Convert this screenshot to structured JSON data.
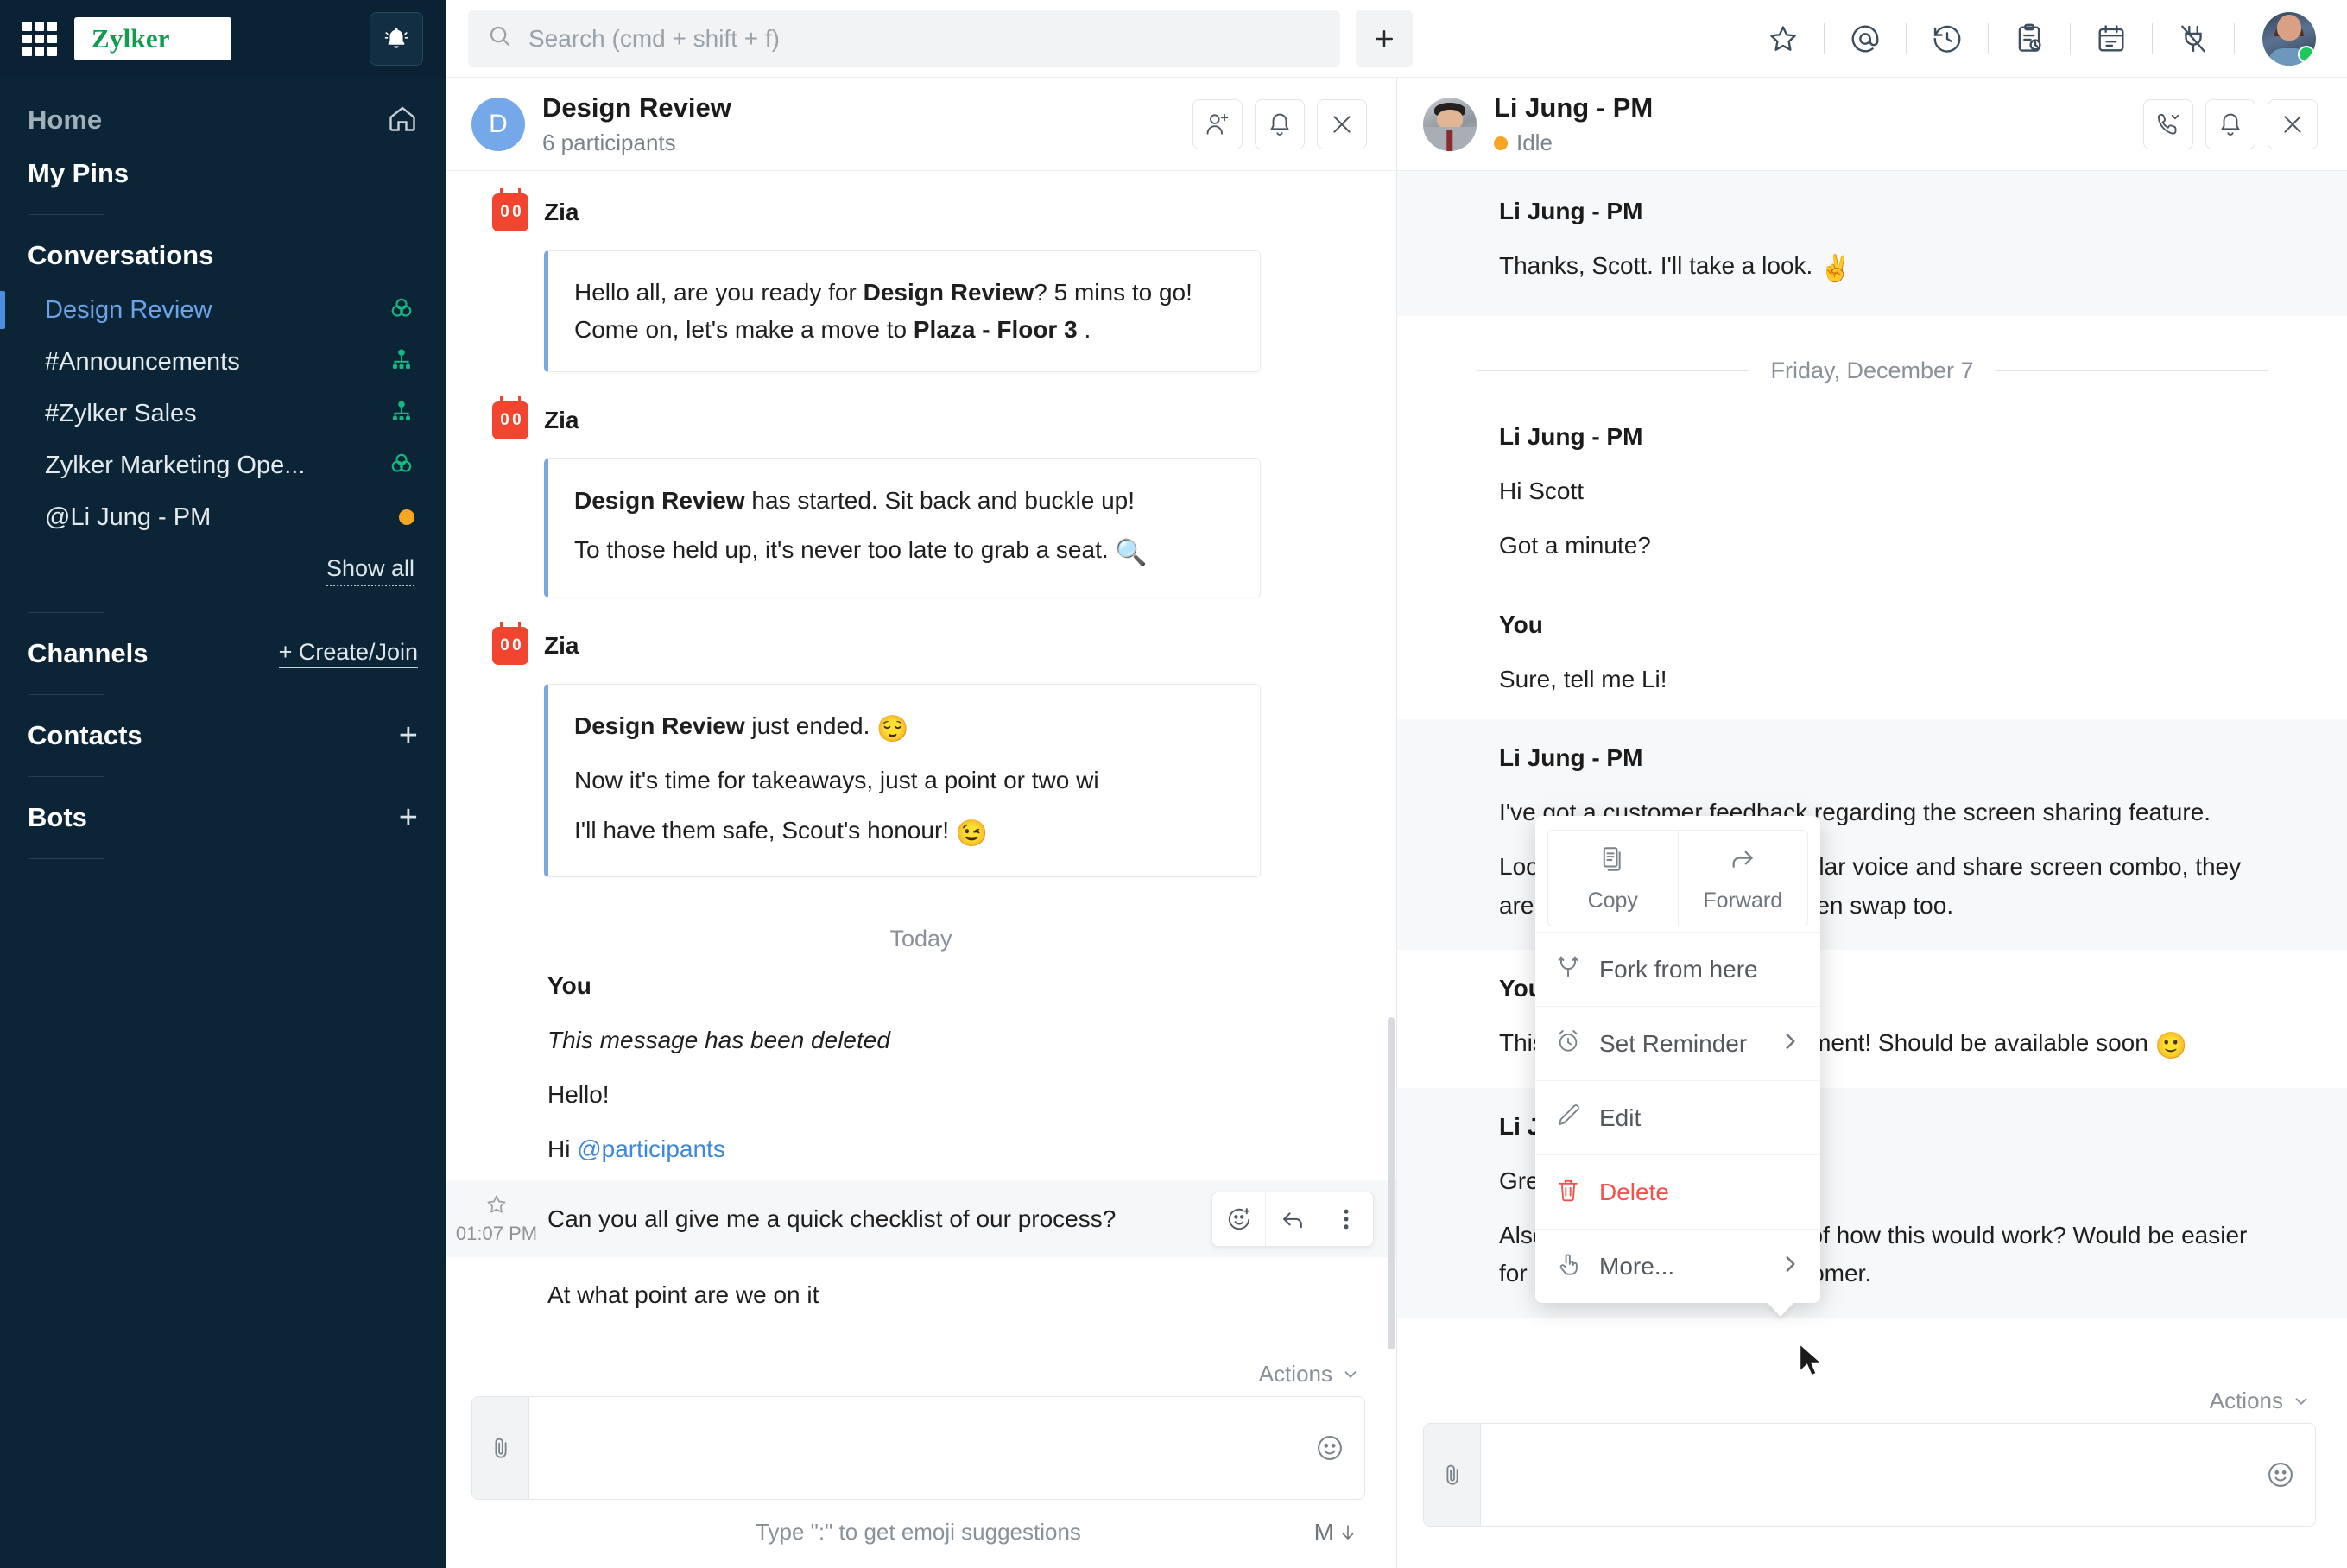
{
  "sidebar": {
    "brand": "Zylker",
    "grid_icon": "apps-grid-icon",
    "bell_icon": "notifications-bell-icon",
    "home": {
      "label": "Home",
      "icon": "home-icon"
    },
    "my_pins": {
      "label": "My Pins"
    },
    "conversations": {
      "title": "Conversations",
      "items": [
        {
          "label": "Design Review",
          "icon": "group-chat-icon",
          "active": true
        },
        {
          "label": "#Announcements",
          "icon": "channel-hierarchy-icon",
          "active": false
        },
        {
          "label": "#Zylker Sales",
          "icon": "channel-hierarchy-icon",
          "active": false
        },
        {
          "label": "Zylker Marketing Ope...",
          "icon": "group-chat-icon",
          "active": false
        },
        {
          "label": "@Li Jung - PM",
          "icon": "status-idle-dot",
          "active": false
        }
      ],
      "show_all": "Show all"
    },
    "channels": {
      "title": "Channels",
      "action": "+ Create/Join"
    },
    "contacts": {
      "title": "Contacts",
      "action_icon": "plus-icon"
    },
    "bots": {
      "title": "Bots",
      "action_icon": "plus-icon"
    }
  },
  "topbar": {
    "search_placeholder": "Search (cmd + shift + f)",
    "search_icon": "search-icon",
    "new_button_icon": "plus-icon",
    "icons": [
      {
        "name": "star-icon"
      },
      {
        "name": "mentions-at-icon"
      },
      {
        "name": "history-clock-icon"
      },
      {
        "name": "tasks-clipboard-icon"
      },
      {
        "name": "calendar-icon"
      },
      {
        "name": "integrations-plug-icon"
      }
    ],
    "avatar": {
      "name": "user-avatar",
      "status": "online"
    }
  },
  "left_pane": {
    "header": {
      "avatar_letter": "D",
      "title": "Design Review",
      "subtitle": "6 participants",
      "buttons": [
        {
          "name": "add-participant-button",
          "icon": "add-person-icon"
        },
        {
          "name": "mute-notifications-button",
          "icon": "bell-icon"
        },
        {
          "name": "close-chat-button",
          "icon": "close-x-icon"
        }
      ]
    },
    "messages": [
      {
        "sender": "Zia",
        "avatar": "zia-bot-icon",
        "type": "bubble",
        "lines": [
          [
            {
              "t": "Hello all, are you ready for ",
              "b": false
            },
            {
              "t": "Design Review",
              "b": true
            },
            {
              "t": "? 5 mins to go! Come on, let's make a move to ",
              "b": false
            },
            {
              "t": "Plaza - Floor 3",
              "b": true
            },
            {
              "t": " .",
              "b": false
            }
          ]
        ]
      },
      {
        "sender": "Zia",
        "avatar": "zia-bot-icon",
        "type": "bubble",
        "lines": [
          [
            {
              "t": "Design Review",
              "b": true
            },
            {
              "t": " has started. Sit back and buckle up!",
              "b": false
            }
          ],
          [
            {
              "t": "To those held up, it's never too late to grab a seat. 🔍",
              "b": false
            }
          ]
        ]
      },
      {
        "sender": "Zia",
        "avatar": "zia-bot-icon",
        "type": "bubble",
        "lines": [
          [
            {
              "t": "Design Review",
              "b": true
            },
            {
              "t": " just ended. 😌",
              "b": false
            }
          ],
          [
            {
              "t": "Now it's time for takeaways, just a point or two wi",
              "b": false
            }
          ],
          [
            {
              "t": "I'll have them safe, Scout's honour! 😉",
              "b": false
            }
          ]
        ]
      }
    ],
    "day_divider": "Today",
    "you_group": {
      "sender": "You",
      "deleted_notice": "This message has been deleted",
      "lines": [
        "Hello!"
      ],
      "mention_line_prefix": "Hi ",
      "mention": "@participants",
      "highlighted": {
        "time": "01:07 PM",
        "text": "Can you all give me a quick checklist of our process?",
        "star_icon": "star-outline-icon",
        "hover_actions": [
          {
            "name": "add-reaction-button",
            "icon": "emoji-plus-icon"
          },
          {
            "name": "reply-button",
            "icon": "reply-arrow-icon"
          },
          {
            "name": "more-options-button",
            "icon": "kebab-menu-icon"
          }
        ]
      },
      "last_line": "At what point are we on it"
    },
    "composer": {
      "actions_label": "Actions",
      "attach_icon": "paperclip-icon",
      "emoji_icon": "smiley-icon",
      "value": "",
      "hint": "Type \":\" to get emoji suggestions",
      "markdown_label": "M"
    }
  },
  "context_menu": {
    "top_actions": [
      {
        "label": "Copy",
        "icon": "copy-icon"
      },
      {
        "label": "Forward",
        "icon": "forward-arrow-icon"
      }
    ],
    "items": [
      {
        "label": "Fork from here",
        "icon": "fork-icon",
        "submenu": false,
        "danger": false
      },
      {
        "label": "Set Reminder",
        "icon": "alarm-clock-icon",
        "submenu": true,
        "danger": false
      },
      {
        "label": "Edit",
        "icon": "pencil-icon",
        "submenu": false,
        "danger": false
      },
      {
        "label": "Delete",
        "icon": "trash-icon",
        "submenu": false,
        "danger": true
      },
      {
        "label": "More...",
        "icon": "hand-tap-icon",
        "submenu": true,
        "danger": false
      }
    ]
  },
  "right_pane": {
    "header": {
      "title": "Li Jung - PM",
      "status": "Idle",
      "status_color": "#f5a623",
      "buttons": [
        {
          "name": "call-button",
          "icon": "phone-icon"
        },
        {
          "name": "mute-notifications-button",
          "icon": "bell-icon"
        },
        {
          "name": "close-chat-button",
          "icon": "close-x-icon"
        }
      ]
    },
    "messages": [
      {
        "sender": "Li Jung - PM",
        "who": "other",
        "lines": [
          "Thanks, Scott. I'll take a look. ✌️"
        ]
      }
    ],
    "day_divider": "Friday, December 7",
    "thread": [
      {
        "sender": "Li Jung - PM",
        "who": "other",
        "lines": [
          "Hi Scott",
          "Got a minute?"
        ]
      },
      {
        "sender": "You",
        "who": "me",
        "lines": [
          "Sure, tell me Li!"
        ]
      },
      {
        "sender": "Li Jung - PM",
        "who": "other",
        "lines": [
          "I've got a customer feedback regarding the screen sharing feature.",
          "Looks like apart from the regular voice and share screen combo, they are looking for video and screen swap too."
        ]
      },
      {
        "sender": "You",
        "who": "me",
        "lines": [
          "This feature is under development! Should be available soon 🙂"
        ]
      },
      {
        "sender": "Li Jung - PM",
        "who": "other",
        "lines": [
          "Great! Any ETA?",
          "Also can you give me a brief of how this would work? Would be easier for me to get back to the customer."
        ]
      }
    ],
    "composer": {
      "actions_label": "Actions",
      "attach_icon": "paperclip-icon",
      "emoji_icon": "smiley-icon",
      "value": ""
    }
  },
  "colors": {
    "sidebar_bg": "#0b2537",
    "brand_green": "#0f9d4f",
    "accent_blue": "#4a90e2",
    "danger_red": "#f0524d",
    "idle_orange": "#f5a623",
    "online_green": "#1ec95b"
  }
}
